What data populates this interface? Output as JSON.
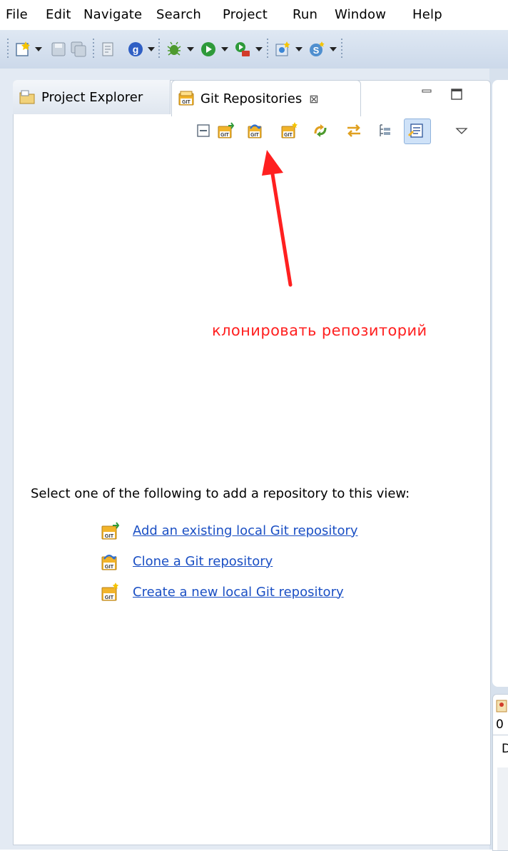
{
  "menu": [
    "File",
    "Edit",
    "Navigate",
    "Search",
    "Project",
    "Run",
    "Window",
    "Help"
  ],
  "tabs": {
    "project_explorer": "Project Explorer",
    "git_repositories": "Git Repositories",
    "close_glyph": "⊠"
  },
  "annotation": {
    "text": "клонировать репозиторий",
    "color": "#ff2020"
  },
  "empty_view": {
    "prompt": "Select one of the following to add a repository to this view:",
    "links": {
      "add_existing": "Add an existing local Git repository",
      "clone": "Clone a Git repository",
      "create_new": "Create a new local Git repository"
    }
  },
  "bottom_panel": {
    "value": "0",
    "letter": "D"
  },
  "colors": {
    "link": "#1a4fc4",
    "toolbar": "#d6e1ee",
    "accent_git": "#f2b42a"
  }
}
